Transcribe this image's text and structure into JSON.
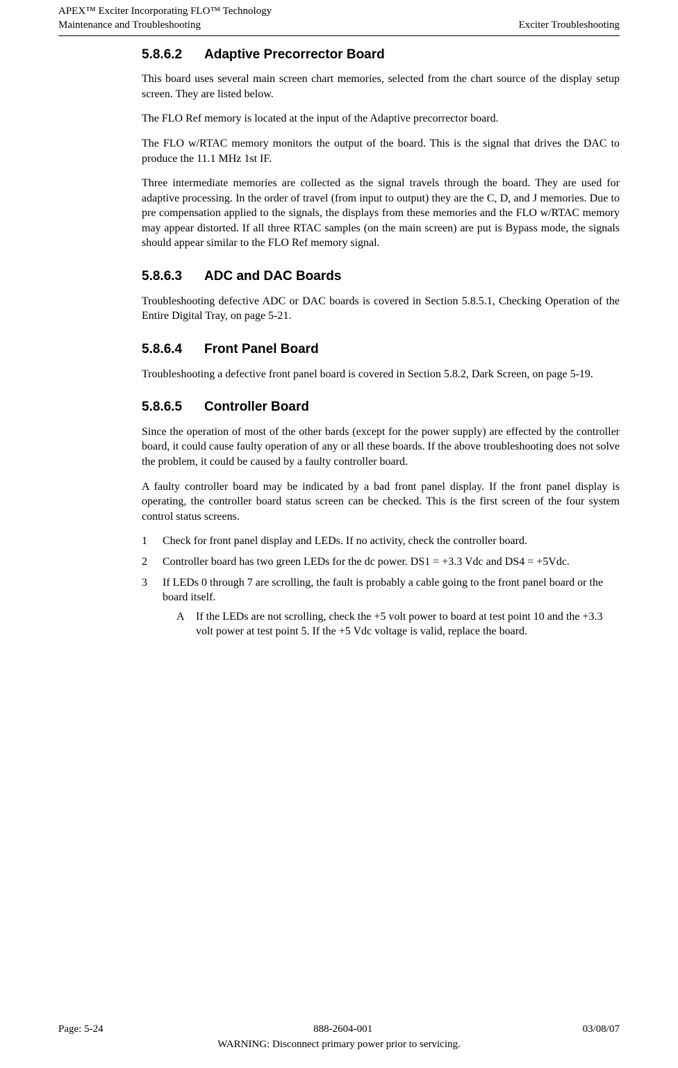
{
  "header": {
    "left_line1": "APEX™ Exciter Incorporating FLO™ Technology",
    "left_line2": "Maintenance and Troubleshooting",
    "right_line2": "Exciter Troubleshooting"
  },
  "sections": {
    "s5862": {
      "num": "5.8.6.2",
      "title": "Adaptive Precorrector Board",
      "p1": "This board uses several main screen chart memories, selected from the chart source of the display setup screen. They are listed below.",
      "p2": "The FLO Ref memory is located at the input of the Adaptive precorrector board.",
      "p3": "The FLO w/RTAC memory monitors the output of the board. This is the signal that drives the DAC to produce the 11.1 MHz 1st IF.",
      "p4": "Three intermediate memories are collected as the signal travels through the board. They are used for adaptive processing. In the order of travel (from input to output) they are the C, D, and J memories. Due to pre compensation applied to the signals, the displays from these memories and the FLO w/RTAC memory may appear distorted. If all three RTAC samples (on the main screen) are put is Bypass mode, the signals should appear similar to the FLO Ref memory signal."
    },
    "s5863": {
      "num": "5.8.6.3",
      "title": "ADC and DAC Boards",
      "p1": "Troubleshooting defective ADC or DAC boards is covered in Section 5.8.5.1, Checking Operation of the Entire Digital Tray, on page 5-21."
    },
    "s5864": {
      "num": "5.8.6.4",
      "title": "Front Panel Board",
      "p1": "Troubleshooting a defective front panel board is covered in Section 5.8.2, Dark Screen, on page 5-19."
    },
    "s5865": {
      "num": "5.8.6.5",
      "title": "Controller Board",
      "p1": "Since the operation of most of the other bards (except for the power supply) are effected by the controller board, it could cause faulty operation of any or all these boards. If the above troubleshooting does not solve the problem, it could be caused by a faulty controller board.",
      "p2": "A faulty controller board may be indicated by a bad front panel display. If the front panel display is operating, the controller board status screen can be checked. This is the first screen of the four system control status screens.",
      "list": [
        {
          "n": "1",
          "t": "Check for front panel display and LEDs. If no activity, check the controller board."
        },
        {
          "n": "2",
          "t": "Controller board has two green LEDs for the dc power. DS1 = +3.3 Vdc and DS4 = +5Vdc."
        },
        {
          "n": "3",
          "t": "If LEDs 0 through 7 are scrolling, the fault is probably a cable going to the front panel board or the board itself.",
          "sub": {
            "l": "A",
            "t": "If the LEDs are not scrolling, check the +5 volt power to board at test point 10 and the +3.3 volt power at test point 5. If the +5 Vdc voltage is valid, replace the board."
          }
        }
      ]
    }
  },
  "footer": {
    "left": "Page: 5-24",
    "center": "888-2604-001",
    "right": "03/08/07",
    "warning": "WARNING: Disconnect primary power prior to servicing."
  }
}
